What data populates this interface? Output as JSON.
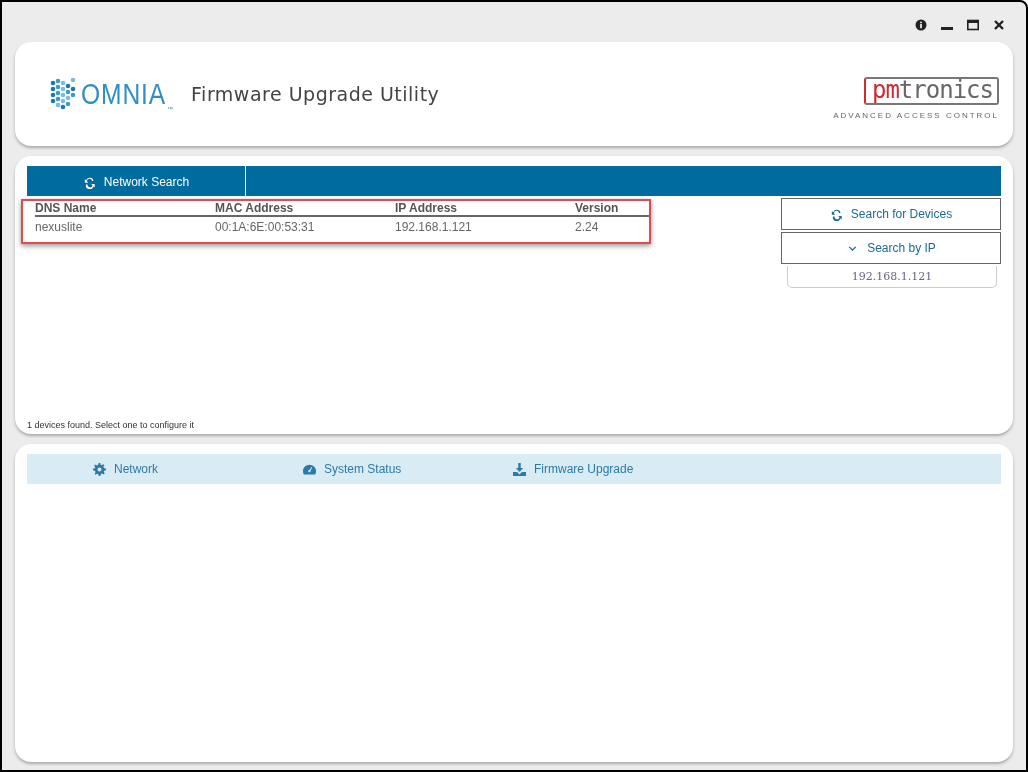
{
  "header": {
    "logo_text": "OMNIA",
    "logo_mark": "™",
    "title": "Firmware Upgrade Utility",
    "brand_red": "pm",
    "brand_grey": "tronics",
    "brand_tagline": "ADVANCED ACCESS CONTROL"
  },
  "search_panel": {
    "tab": "Network Search",
    "table": {
      "columns": [
        "DNS Name",
        "MAC Address",
        "IP Address",
        "Version"
      ],
      "rows": [
        {
          "cells": [
            "nexuslite",
            "00:1A:6E:00:53:31",
            "192.168.1.121",
            "2.24"
          ]
        }
      ]
    },
    "status": "1 devices found. Select one to configure it",
    "search_button": "Search for Devices",
    "search_by_ip_button": "Search by IP",
    "ip_field": {
      "value": "192.168.1.121"
    }
  },
  "config_tabs": [
    {
      "label": "Network"
    },
    {
      "label": "System Status"
    },
    {
      "label": "Firmware Upgrade"
    }
  ]
}
